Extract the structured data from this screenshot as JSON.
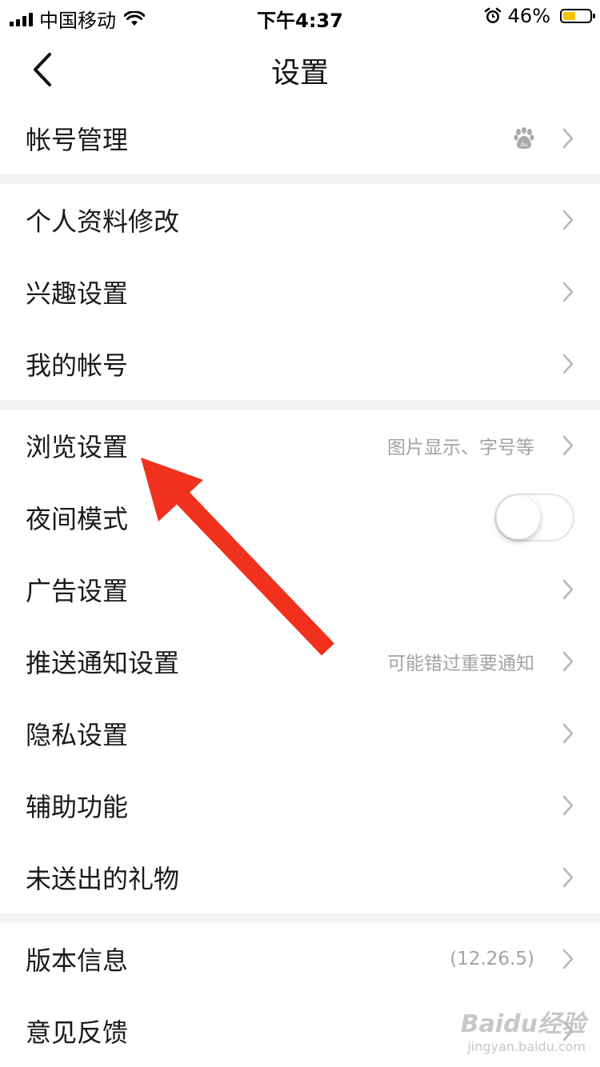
{
  "status_bar": {
    "carrier": "中国移动",
    "time": "下午4:37",
    "battery_percent_text": "46%",
    "battery_level": 0.46,
    "battery_color": "#f5c400"
  },
  "nav": {
    "title": "设置",
    "back_icon": "chevron-left-icon"
  },
  "sections": [
    {
      "items": [
        {
          "label": "帐号管理",
          "value": "",
          "trailing": "baidu-paw-icon"
        }
      ]
    },
    {
      "items": [
        {
          "label": "个人资料修改",
          "value": ""
        },
        {
          "label": "兴趣设置",
          "value": ""
        },
        {
          "label": "我的帐号",
          "value": ""
        }
      ]
    },
    {
      "items": [
        {
          "label": "浏览设置",
          "value": "图片显示、字号等"
        },
        {
          "label": "夜间模式",
          "value": "",
          "toggle": false
        },
        {
          "label": "广告设置",
          "value": ""
        },
        {
          "label": "推送通知设置",
          "value": "可能错过重要通知"
        },
        {
          "label": "隐私设置",
          "value": ""
        },
        {
          "label": "辅助功能",
          "value": ""
        },
        {
          "label": "未送出的礼物",
          "value": ""
        }
      ]
    },
    {
      "items": [
        {
          "label": "版本信息",
          "value": "(12.26.5)"
        },
        {
          "label": "意见反馈",
          "value": ""
        }
      ]
    }
  ],
  "annotation": {
    "arrow_color": "#f0311d"
  },
  "watermark": {
    "brand": "Baidu经验",
    "url": "jingyan.baidu.com"
  }
}
